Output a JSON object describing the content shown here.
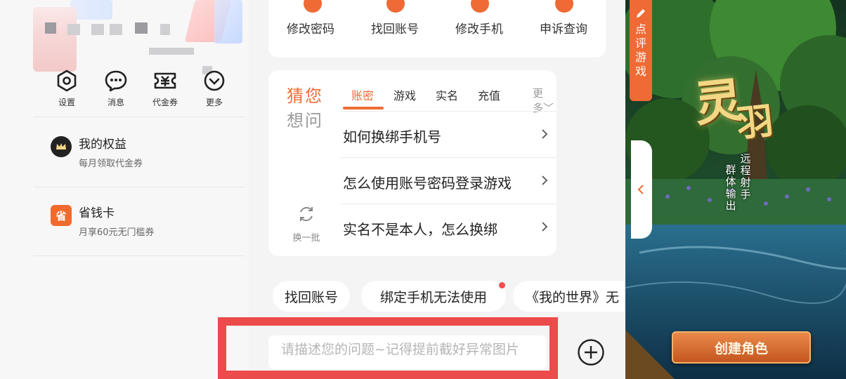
{
  "left_panel": {
    "shortcuts": [
      {
        "icon": "gear-icon",
        "label": "设置"
      },
      {
        "icon": "message-icon",
        "label": "消息"
      },
      {
        "icon": "coupon-icon",
        "label": "代金券"
      },
      {
        "icon": "chevron-down-icon",
        "label": "更多"
      }
    ],
    "perks": [
      {
        "icon": "crown-icon",
        "title": "我的权益",
        "subtitle": "每月领取代金券"
      },
      {
        "icon": "saver-card-icon",
        "icon_text": "省",
        "title": "省钱卡",
        "subtitle": "月享60元无门槛券"
      }
    ]
  },
  "top_actions": [
    "修改密码",
    "找回账号",
    "修改手机",
    "申诉查询"
  ],
  "guess": {
    "title_line1": "猜您",
    "title_line2": "想问",
    "refresh_label": "换一批",
    "tabs": [
      "账密",
      "游戏",
      "实名",
      "充值"
    ],
    "active_tab": "账密",
    "more_label": "更多",
    "questions": [
      "如何换绑手机号",
      "怎么使用账号密码登录游戏",
      "实名不是本人，怎么换绑"
    ]
  },
  "chips": [
    "找回账号",
    "绑定手机无法使用",
    "《我的世界》无"
  ],
  "input": {
    "placeholder": "请描述您的问题~记得提前截好异常图片"
  },
  "game_ad": {
    "side_tag": [
      "点",
      "评",
      "游",
      "戏"
    ],
    "logo_chars": [
      "灵",
      "羽"
    ],
    "tagline_col1": "远程射手",
    "tagline_col2": "群体输出",
    "cta_label": "创建角色"
  },
  "colors": {
    "accent": "#ee6d34",
    "annotation_frame": "#ec4b4b"
  }
}
